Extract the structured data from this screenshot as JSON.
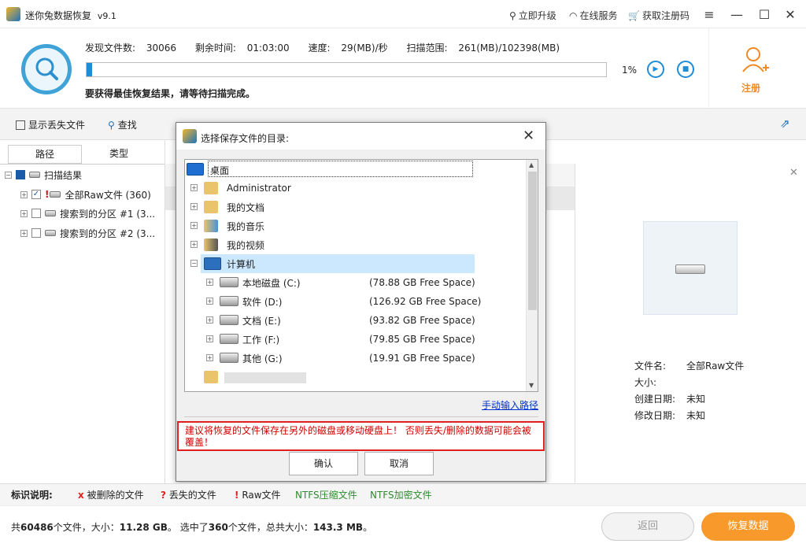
{
  "titlebar": {
    "app_title": "迷你兔数据恢复",
    "version": "v9.1",
    "upgrade": "立即升级",
    "online_service": "在线服务",
    "get_code": "获取注册码"
  },
  "scan": {
    "found_label": "发现文件数:",
    "found_value": "30066",
    "remaining_label": "剩余时间:",
    "remaining_value": "01:03:00",
    "speed_label": "速度:",
    "speed_value": "29(MB)/秒",
    "range_label": "扫描范围:",
    "range_value": "261(MB)/102398(MB)",
    "progress_percent": "1%",
    "progress_value": 0.01,
    "tip": "要获得最佳恢复结果，请等待扫描完成。",
    "register": "注册"
  },
  "toolbar": {
    "show_lost": "显示丢失文件",
    "search": "查找"
  },
  "left_tabs": {
    "path": "路径",
    "type": "类型"
  },
  "tree": {
    "root": "扫描结果",
    "items": [
      {
        "label": "全部Raw文件 (360)",
        "checked": true
      },
      {
        "label": "搜索到的分区 #1 (3...",
        "checked": false
      },
      {
        "label": "搜索到的分区 #2 (3...",
        "checked": false
      }
    ]
  },
  "dialog": {
    "title": "选择保存文件的目录:",
    "root": "桌面",
    "folders": [
      "Administrator",
      "我的文档",
      "我的音乐",
      "我的视频",
      "计算机"
    ],
    "drives": [
      {
        "label": "本地磁盘 (C:)",
        "free": "(78.88 GB Free Space)"
      },
      {
        "label": "软件 (D:)",
        "free": "(126.92 GB Free Space)"
      },
      {
        "label": "文档 (E:)",
        "free": "(93.82 GB Free Space)"
      },
      {
        "label": "工作 (F:)",
        "free": "(79.85 GB Free Space)"
      },
      {
        "label": "其他 (G:)",
        "free": "(19.91 GB Free Space)"
      }
    ],
    "manual_link": "手动输入路径",
    "warning": "建议将恢复的文件保存在另外的磁盘或移动硬盘上！ 否则丢失/删除的数据可能会被覆盖！",
    "ok": "确认",
    "cancel": "取消"
  },
  "file_info": {
    "name_label": "文件名:",
    "name_value": "全部Raw文件",
    "size_label": "大小:",
    "created_label": "创建日期:",
    "created_value": "未知",
    "modified_label": "修改日期:",
    "modified_value": "未知"
  },
  "legend": {
    "title": "标识说明:",
    "deleted": "被删除的文件",
    "lost": "丢失的文件",
    "raw": "Raw文件",
    "ntfs_compressed": "NTFS压缩文件",
    "ntfs_encrypted": "NTFS加密文件",
    "colors": {
      "red": "#e02020",
      "green": "#2e8b2e"
    }
  },
  "status": {
    "text_prefix": "共",
    "total_files": "60486",
    "text_mid1": "个文件，大小：",
    "total_size": "11.28 GB",
    "text_mid2": "。 选中了",
    "selected_files": "360",
    "text_mid3": "个文件，总共大小：",
    "selected_size": "143.3 MB",
    "text_end": "。",
    "back": "返回",
    "recover": "恢复数据"
  }
}
